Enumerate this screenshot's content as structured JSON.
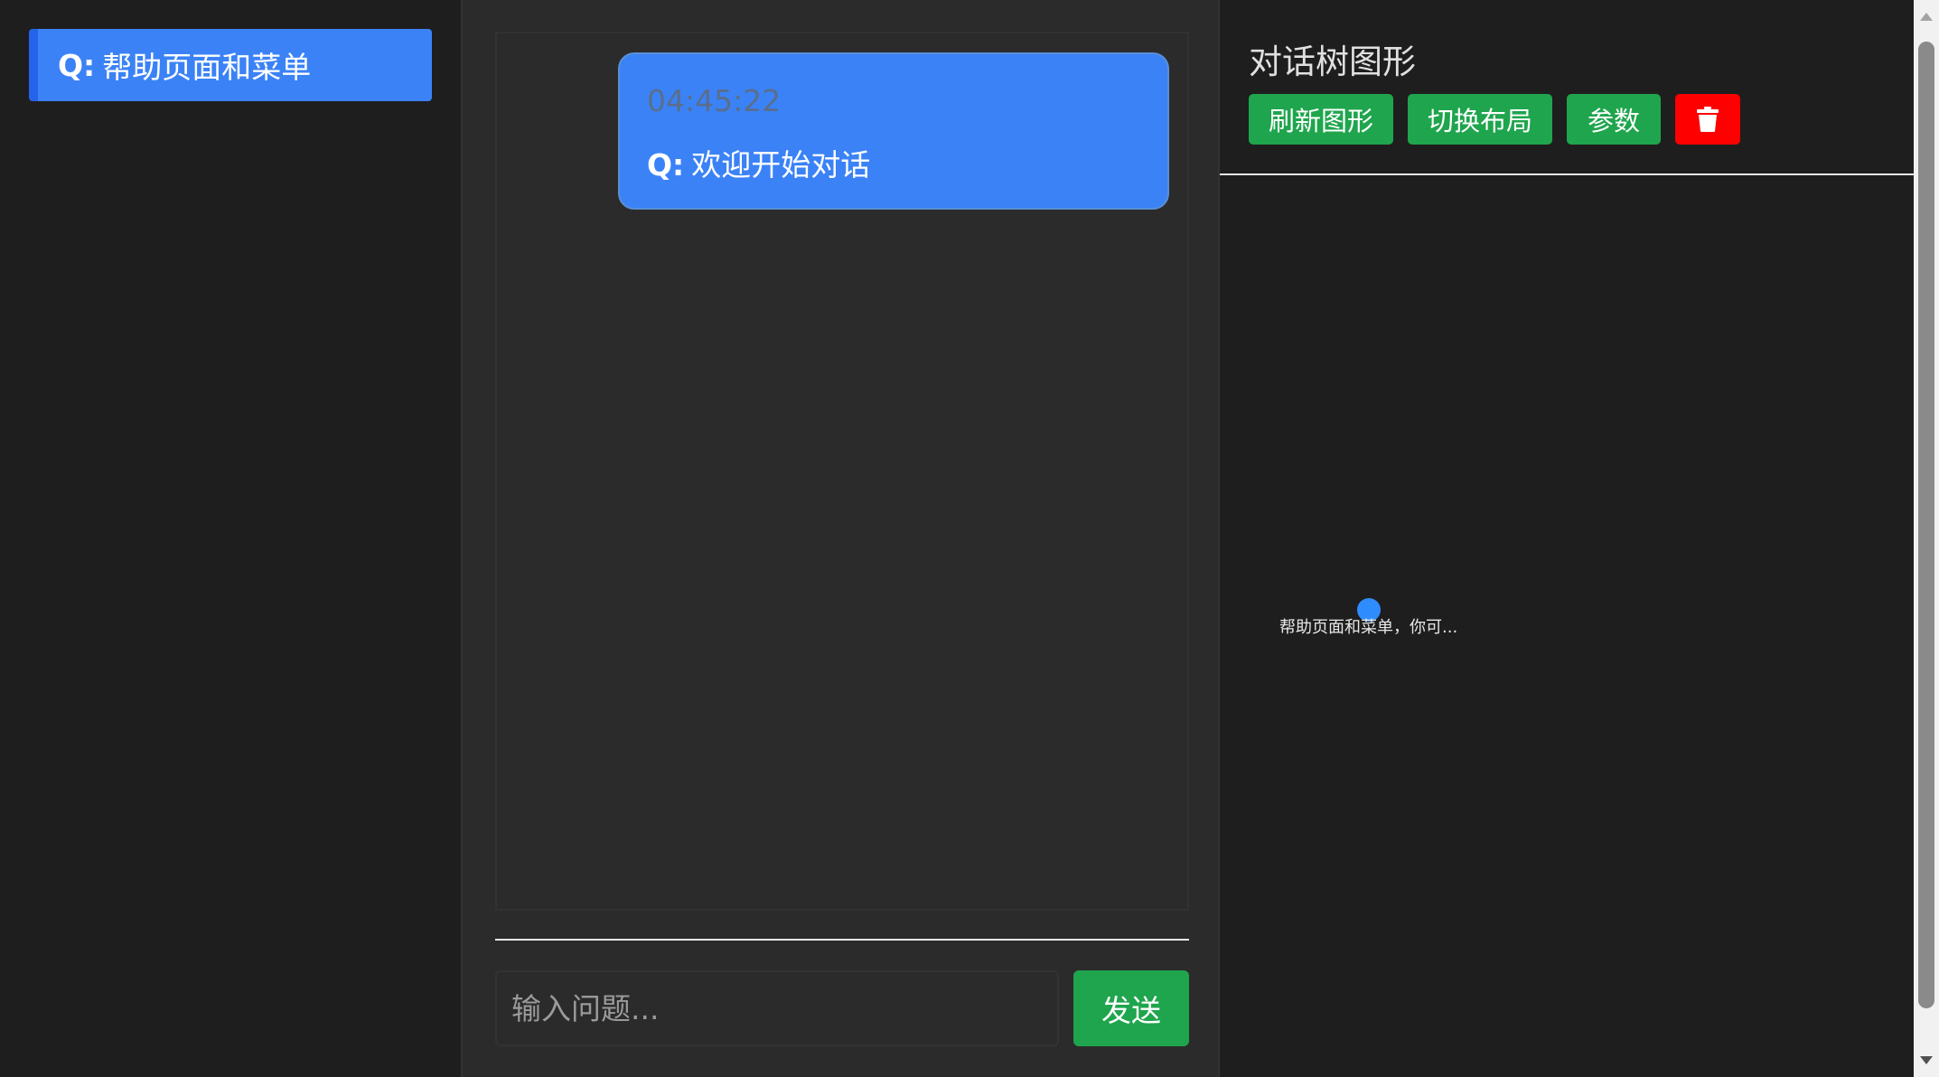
{
  "sidebar": {
    "items": [
      {
        "prefix": "Q:",
        "label": "帮助页面和菜单"
      }
    ]
  },
  "chat": {
    "messages": [
      {
        "time": "04:45:22",
        "prefix": "Q:",
        "text": "欢迎开始对话"
      }
    ],
    "input": {
      "placeholder": "输入问题...",
      "value": ""
    },
    "send_label": "发送"
  },
  "tree": {
    "title": "对话树图形",
    "toolbar": {
      "refresh_label": "刷新图形",
      "layout_label": "切换布局",
      "params_label": "参数",
      "delete_icon": "trash-icon"
    },
    "nodes": [
      {
        "label": "帮助页面和菜单，你可..."
      }
    ]
  },
  "colors": {
    "accent_blue": "#3b82f6",
    "send_green": "#1fa54d",
    "delete_red": "#ff0000",
    "node_blue": "#2f8cff"
  }
}
